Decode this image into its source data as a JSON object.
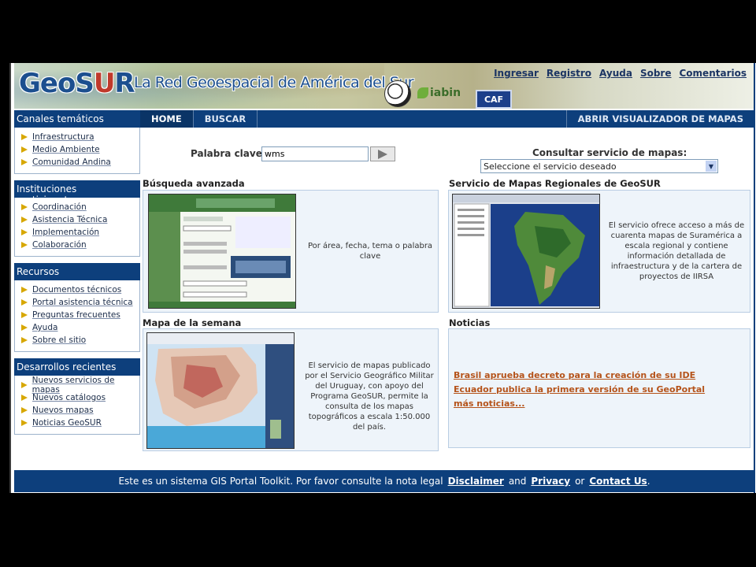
{
  "header": {
    "logo_geo": "GeoS",
    "logo_u": "U",
    "logo_r": "R",
    "tagline": "La Red Geoespacial de América del Sur",
    "iabin": "iabin",
    "caf": "CAF",
    "links": [
      "Ingresar",
      "Registro",
      "Ayuda",
      "Sobre",
      "Comentarios"
    ]
  },
  "nav": {
    "home": "HOME",
    "buscar": "BUSCAR",
    "visualizador": "ABRIR VISUALIZADOR DE MAPAS"
  },
  "sidebar": {
    "sections": [
      {
        "title": "Canales temáticos",
        "items": [
          "Infraestructura",
          "Medio Ambiente",
          "Comunidad Andina"
        ]
      },
      {
        "title": "Instituciones participantes",
        "items": [
          "Coordinación",
          "Asistencia Técnica",
          "Implementación",
          "Colaboración"
        ]
      },
      {
        "title": "Recursos",
        "items": [
          "Documentos técnicos",
          "Portal asistencia técnica",
          "Preguntas frecuentes",
          "Ayuda",
          "Sobre el sitio"
        ]
      },
      {
        "title": "Desarrollos recientes",
        "items": [
          "Nuevos servicios de mapas",
          "Nuevos catálogos",
          "Nuevos mapas",
          "Noticias GeoSUR"
        ]
      }
    ]
  },
  "search": {
    "label": "Palabra clave:",
    "value": "wms"
  },
  "map_service": {
    "label": "Consultar servicio de mapas:",
    "selected": "Seleccione el servicio deseado"
  },
  "sections": {
    "busqueda_title": "Búsqueda avanzada",
    "busqueda_text": "Por área, fecha, tema o palabra clave",
    "servicio_title": "Servicio de Mapas Regionales de GeoSUR",
    "servicio_text": "El servicio ofrece acceso a más de cuarenta mapas de Suramérica a escala regional y contiene información detallada de infraestructura y de la cartera de proyectos de IIRSA",
    "mapa_title": "Mapa de la semana",
    "mapa_text": "El servicio de mapas publicado por el Servicio Geográfico Militar del Uruguay, con apoyo del Programa GeoSUR, permite la consulta de los mapas topográficos a escala 1:50.000 del país.",
    "noticias_title": "Noticias"
  },
  "news": [
    "Brasil aprueba decreto para la creación de su IDE",
    "Ecuador publica la primera versión de su GeoPortal",
    "más noticias..."
  ],
  "footer": {
    "text1": "Este es un sistema GIS Portal Toolkit. Por favor consulte la nota legal",
    "disclaimer": "Disclaimer",
    "and": "and",
    "privacy": "Privacy",
    "or": "or",
    "contact": "Contact Us",
    "dot": "."
  },
  "colors": {
    "navy": "#0d3f7c",
    "news_link": "#b5531a"
  }
}
